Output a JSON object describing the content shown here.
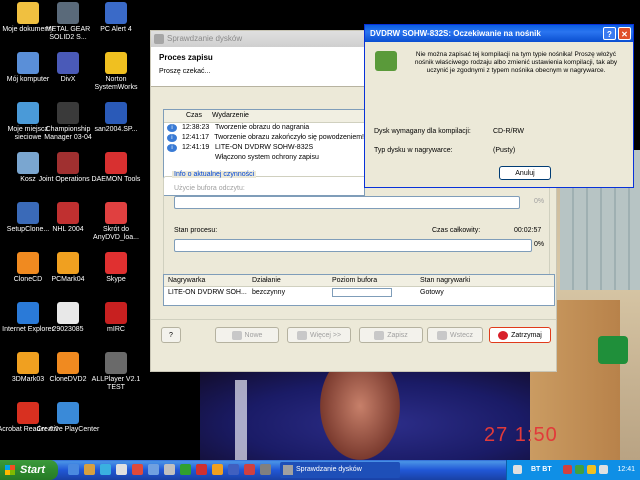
{
  "desktop": {
    "icons": [
      {
        "label": "Moje dokumenty",
        "icon": "folder-icon",
        "color": "#f0c040"
      },
      {
        "label": "Mój komputer",
        "icon": "computer-icon",
        "color": "#5a8fd8"
      },
      {
        "label": "Moje miejsca sieciowe",
        "icon": "network-icon",
        "color": "#4a9ad8"
      },
      {
        "label": "Kosz",
        "icon": "recycle-bin-icon",
        "color": "#7aa6d0"
      },
      {
        "label": "SetupClone...",
        "icon": "setup-icon",
        "color": "#3a6ab8"
      },
      {
        "label": "CloneCD",
        "icon": "clonecd-icon",
        "color": "#f08a20"
      },
      {
        "label": "Internet Explorer",
        "icon": "ie-icon",
        "color": "#2a7ad8"
      },
      {
        "label": "3DMark03",
        "icon": "3dmark-icon",
        "color": "#f0a020"
      },
      {
        "label": "Acrobat Reader 4.0",
        "icon": "acrobat-icon",
        "color": "#d83020"
      },
      {
        "label": "METAL GEAR SOLID2 S...",
        "icon": "mgs-icon",
        "color": "#5a6a7a"
      },
      {
        "label": "DivX",
        "icon": "divx-icon",
        "color": "#4a5ab8"
      },
      {
        "label": "Championship Manager 03-04",
        "icon": "cm-icon",
        "color": "#3a3a3a"
      },
      {
        "label": "Joint Operations ...",
        "icon": "joint-ops-icon",
        "color": "#a03030"
      },
      {
        "label": "NHL 2004",
        "icon": "nhl-icon",
        "color": "#c03030"
      },
      {
        "label": "PCMark04",
        "icon": "pcmark-icon",
        "color": "#f0a020"
      },
      {
        "label": "29023085",
        "icon": "document-icon",
        "color": "#e8e8e8"
      },
      {
        "label": "CloneDVD2",
        "icon": "clonedvd-icon",
        "color": "#f08a20"
      },
      {
        "label": "Creative PlayCenter",
        "icon": "creative-icon",
        "color": "#3a8ad8"
      },
      {
        "label": "PC Alert 4",
        "icon": "pc-alert-icon",
        "color": "#3a6ac8"
      },
      {
        "label": "Norton SystemWorks",
        "icon": "norton-icon",
        "color": "#f0c020"
      },
      {
        "label": "san2004.SP...",
        "icon": "shortcut-icon",
        "color": "#2a5ab8"
      },
      {
        "label": "DAEMON Tools",
        "icon": "daemon-icon",
        "color": "#d83030"
      },
      {
        "label": "Skrót do AnyDVD_loa...",
        "icon": "anydvd-icon",
        "color": "#e04040"
      },
      {
        "label": "Skype",
        "icon": "skype-icon",
        "color": "#e03030"
      },
      {
        "label": "mIRC",
        "icon": "mirc-icon",
        "color": "#c82020"
      },
      {
        "label": "ALLPlayer V2.1 TEST",
        "icon": "allplayer-icon",
        "color": "#6a6a6a"
      }
    ],
    "timestamp": "27   1:50"
  },
  "main_window": {
    "title": "Sprawdzanie dysków",
    "header_title": "Proces zapisu",
    "header_subtitle": "Proszę czekać...",
    "log_columns": {
      "time": "Czas",
      "event": "Wydarzenie"
    },
    "log_rows": [
      {
        "icon": "info-icon",
        "time": "12:38:23",
        "event": "Tworzenie obrazu do nagrania"
      },
      {
        "icon": "info-icon",
        "time": "12:41:17",
        "event": "Tworzenie obrazu zakończyło się powodzeniem!"
      },
      {
        "icon": "info-icon",
        "time": "12:41:19",
        "event": "LITE-ON DVDRW SOHW-832S"
      },
      {
        "icon": "",
        "time": "",
        "event": "Włączono system ochrony zapisu"
      }
    ],
    "group_legend": "Info o aktualnej czynności",
    "buffer_usage_label": "Użycie bufora odczytu:",
    "buffer_pct": "0%",
    "process_label": "Stan procesu:",
    "total_time_label": "Czas całkowity:",
    "total_time": "00:02:57",
    "process_pct": "0%",
    "drive_columns": [
      "Nagrywarka",
      "Działanie",
      "Poziom bufora",
      "Stan nagrywarki"
    ],
    "drive_row": {
      "drive": "LITE-ON DVDRW SOH...",
      "action": "bezczynny",
      "buffer_level": 0,
      "state": "Gotowy"
    },
    "buttons": {
      "help": "?",
      "new": "Nowe",
      "more": "Więcej >>",
      "save": "Zapisz",
      "back": "Wstecz",
      "stop": "Zatrzymaj"
    }
  },
  "dialog": {
    "title": "DVDRW SOHW-832S: Oczekiwanie na nośnik",
    "help_label": "?",
    "close_label": "✕",
    "message": "Nie można zapisać tej kompilacji na tym typie nośnika! Proszę włożyć nośnik właściwego rodzaju albo zmienić ustawienia kompilacji, tak aby uczynić je zgodnymi z typem nośnika obecnym w nagrywarce.",
    "required_label": "Dysk wymagany dla kompilacji:",
    "required_value": "CD-R/RW",
    "drive_type_label": "Typ dysku w nagrywarce:",
    "drive_type_value": "(Pusty)",
    "cancel_label": "Anuluj"
  },
  "taskbar": {
    "start_label": "Start",
    "task_label": "Sprawdzanie dysków",
    "tray_label": "BT BT",
    "clock": "12:41"
  },
  "colors": {
    "xp_blue": "#2157d7",
    "dialog_title": "#0a5ee0",
    "start_green": "#2e8a2e",
    "stop_red": "#e03a1a"
  }
}
